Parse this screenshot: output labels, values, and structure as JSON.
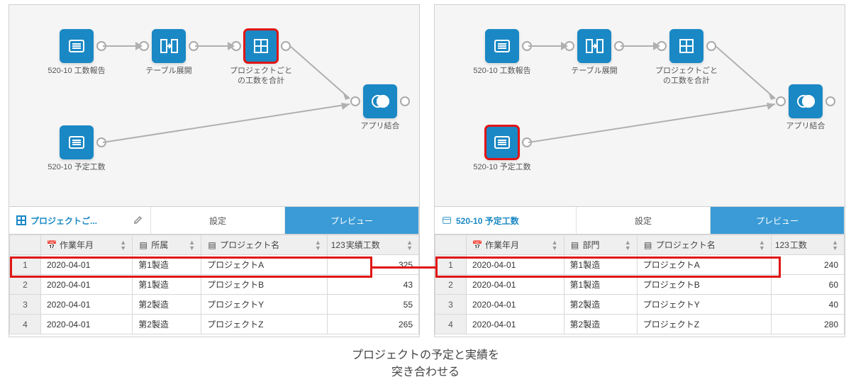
{
  "caption_line1": "プロジェクトの予定と実績を",
  "caption_line2": "突き合わせる",
  "left": {
    "nodes": {
      "n1": "520-10 工数報告",
      "n2": "テーブル展開",
      "n3": "プロジェクトごとの工数を合計",
      "n4": "アプリ結合",
      "n5": "520-10 予定工数"
    },
    "title": "プロジェクトご...",
    "tabs": {
      "settings": "設定",
      "preview": "プレビュー"
    },
    "cols": {
      "c1": "作業年月",
      "c2": "所属",
      "c3": "プロジェクト名",
      "c4": "実績工数"
    },
    "rows": [
      {
        "n": "1",
        "date": "2020-04-01",
        "dept": "第1製造",
        "proj": "プロジェクトA",
        "val": "325"
      },
      {
        "n": "2",
        "date": "2020-04-01",
        "dept": "第1製造",
        "proj": "プロジェクトB",
        "val": "43"
      },
      {
        "n": "3",
        "date": "2020-04-01",
        "dept": "第2製造",
        "proj": "プロジェクトY",
        "val": "55"
      },
      {
        "n": "4",
        "date": "2020-04-01",
        "dept": "第2製造",
        "proj": "プロジェクトZ",
        "val": "265"
      }
    ]
  },
  "right": {
    "nodes": {
      "n1": "520-10 工数報告",
      "n2": "テーブル展開",
      "n3": "プロジェクトごとの工数を合計",
      "n4": "アプリ結合",
      "n5": "520-10 予定工数"
    },
    "title": "520-10 予定工数",
    "tabs": {
      "settings": "設定",
      "preview": "プレビュー"
    },
    "cols": {
      "c1": "作業年月",
      "c2": "部門",
      "c3": "プロジェクト名",
      "c4": "工数"
    },
    "rows": [
      {
        "n": "1",
        "date": "2020-04-01",
        "dept": "第1製造",
        "proj": "プロジェクトA",
        "val": "240"
      },
      {
        "n": "2",
        "date": "2020-04-01",
        "dept": "第1製造",
        "proj": "プロジェクトB",
        "val": "60"
      },
      {
        "n": "3",
        "date": "2020-04-01",
        "dept": "第2製造",
        "proj": "プロジェクトY",
        "val": "40"
      },
      {
        "n": "4",
        "date": "2020-04-01",
        "dept": "第2製造",
        "proj": "プロジェクトZ",
        "val": "280"
      }
    ]
  }
}
